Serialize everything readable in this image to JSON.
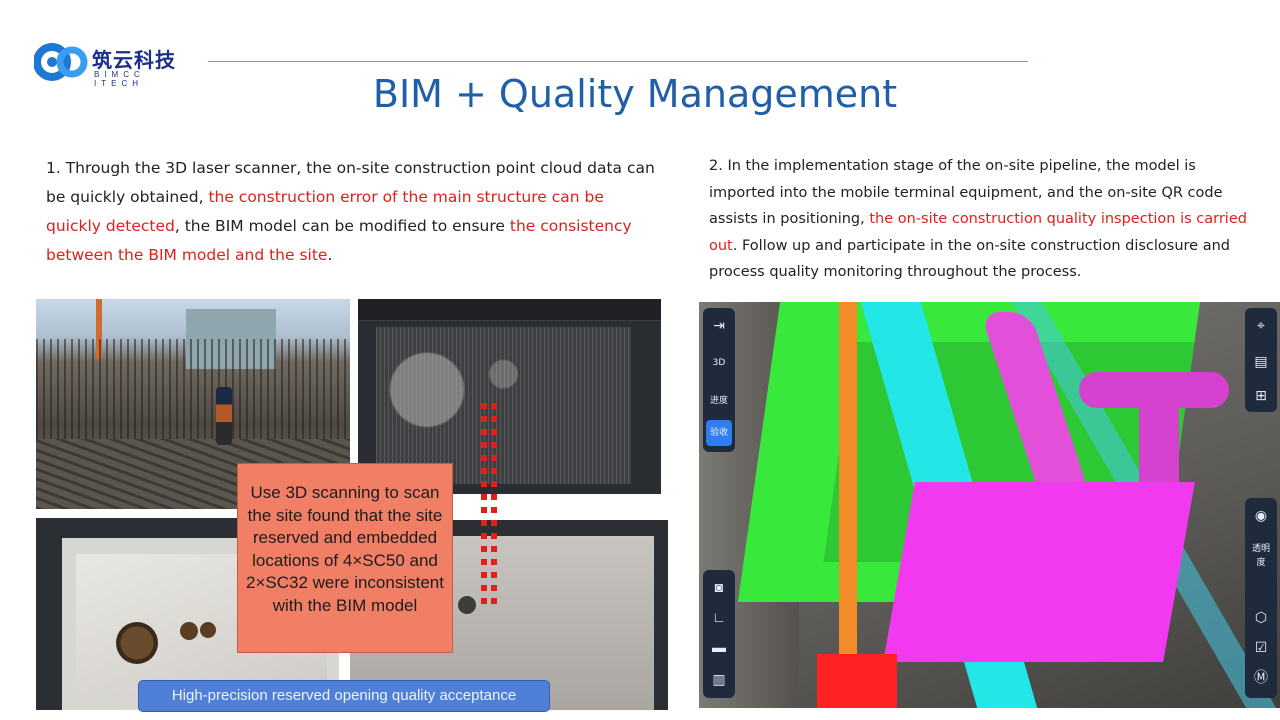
{
  "logo": {
    "name_cn": "筑云科技",
    "name_en": "BIMCC ITECH"
  },
  "title": "BIM + Quality Management",
  "paragraph_1": {
    "part_1": "1. Through the 3D laser scanner, the on-site construction point cloud data can be quickly obtained, ",
    "highlight_1": "the construction error of the main structure can be quickly detected",
    "part_2": ", the BIM model can be modified to ensure ",
    "highlight_2": "the consistency between the BIM model and the site",
    "part_3": "."
  },
  "paragraph_2": {
    "part_1": "2. In the implementation stage of the on-site pipeline, the model is imported into the mobile terminal equipment, and the on-site QR code assists in positioning, ",
    "highlight_1": "the on-site construction quality inspection is carried out",
    "part_2": ". Follow up and participate in the on-site construction disclosure and process quality monitoring throughout the process."
  },
  "callout": "Use 3D scanning to scan the site found that the site reserved and embedded locations of 4×SC50 and 2×SC32 were inconsistent with the BIM model",
  "caption": "High-precision reserved opening quality acceptance",
  "app": {
    "left_toolbar_top": [
      {
        "icon": "exit-icon",
        "glyph": "⇥"
      },
      {
        "icon": "3d-view-icon",
        "label": "3D"
      },
      {
        "label": "进度"
      },
      {
        "label": "验收",
        "active": true
      }
    ],
    "left_toolbar_bottom": [
      {
        "icon": "camera-icon",
        "glyph": "◙"
      },
      {
        "icon": "measure-icon",
        "glyph": "∟"
      },
      {
        "icon": "folder-icon",
        "glyph": "▬"
      },
      {
        "icon": "map-icon",
        "glyph": "▥"
      }
    ],
    "right_toolbar_top": [
      {
        "icon": "location-pin-icon",
        "glyph": "⌖"
      },
      {
        "icon": "clipboard-icon",
        "glyph": "▤"
      },
      {
        "icon": "add-icon",
        "glyph": "⊞"
      }
    ],
    "right_toolbar_bottom": [
      {
        "icon": "eye-icon",
        "glyph": "◉"
      },
      {
        "label": "透明度"
      },
      {
        "icon": "cube-icon",
        "glyph": "⬡"
      },
      {
        "icon": "check-document-icon",
        "glyph": "☑"
      },
      {
        "icon": "m-circle-icon",
        "glyph": "Ⓜ"
      }
    ]
  }
}
